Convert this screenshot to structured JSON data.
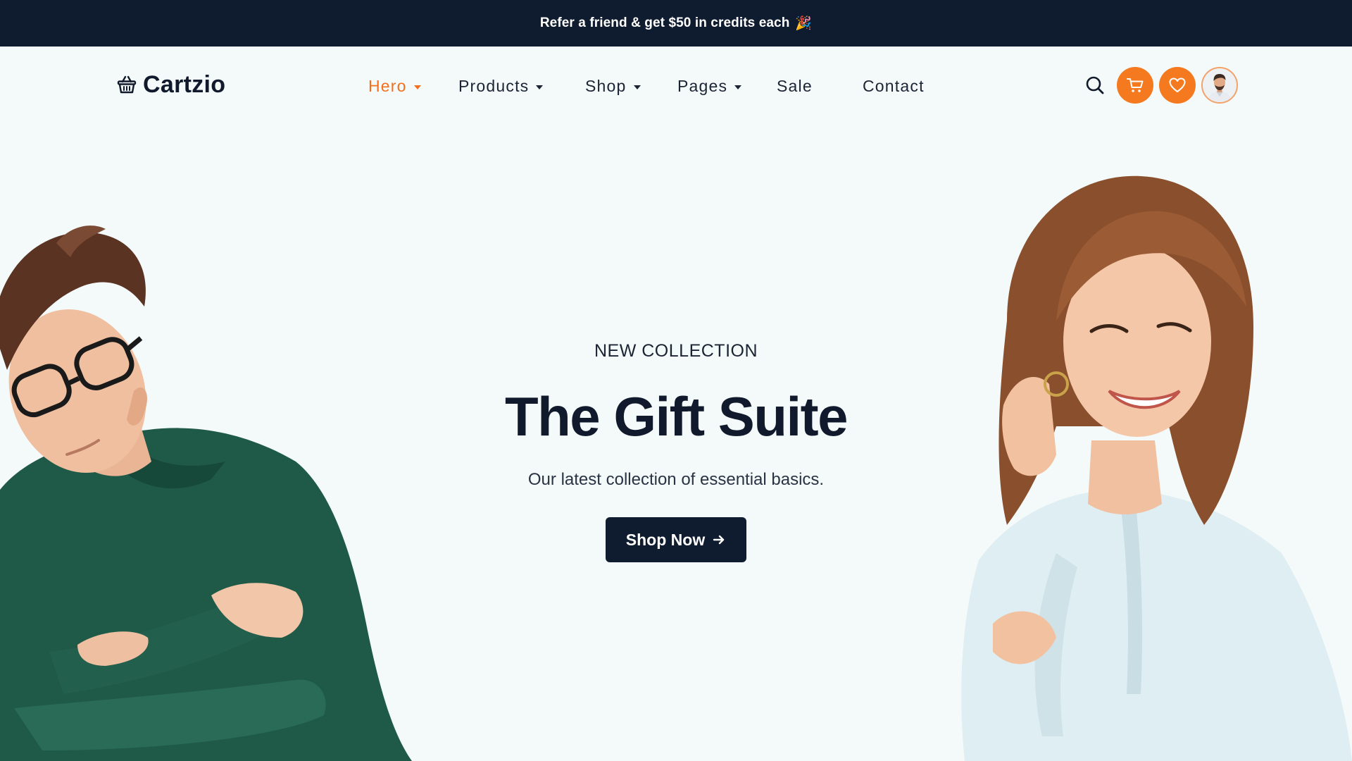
{
  "promo": {
    "text": "Refer a friend & get $50 in credits each",
    "emoji": "🎉"
  },
  "brand": {
    "name": "Cartzio",
    "icon": "basket-icon"
  },
  "nav": {
    "items": [
      {
        "label": "Hero",
        "active": true,
        "has_dropdown": true
      },
      {
        "label": "Products",
        "active": false,
        "has_dropdown": true
      },
      {
        "label": "Shop",
        "active": false,
        "has_dropdown": true
      },
      {
        "label": "Pages",
        "active": false,
        "has_dropdown": true
      },
      {
        "label": "Sale",
        "active": false,
        "has_dropdown": false
      },
      {
        "label": "Contact",
        "active": false,
        "has_dropdown": false
      }
    ]
  },
  "actions": {
    "search_icon": "search-icon",
    "cart_icon": "cart-icon",
    "wishlist_icon": "heart-icon",
    "avatar_icon": "user-avatar"
  },
  "hero": {
    "eyebrow": "NEW COLLECTION",
    "title": "The Gift Suite",
    "subtitle": "Our latest collection of essential basics.",
    "cta_label": "Shop Now",
    "cta_icon": "arrow-right-icon"
  },
  "colors": {
    "accent": "#f57a1f",
    "dark": "#0f1b2e",
    "background": "#f4faf9",
    "sweater": "#1f5a48",
    "shirt": "#dfeef2"
  }
}
